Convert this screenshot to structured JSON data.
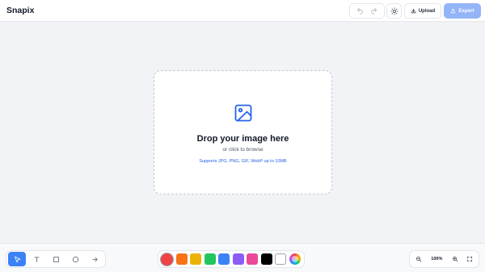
{
  "header": {
    "title": "Snapix",
    "undo_icon": "undo-icon",
    "redo_icon": "redo-icon",
    "theme_icon": "sun-icon",
    "upload_label": "Upload",
    "export_label": "Export"
  },
  "dropzone": {
    "icon": "image-icon",
    "title": "Drop your image here",
    "subtitle": "or click to browse",
    "formats": "Supports JPG, PNG, GIF, WebP up to 10MB"
  },
  "toolbar": {
    "tools": [
      {
        "name": "select",
        "icon": "cursor-icon",
        "active": true
      },
      {
        "name": "text",
        "icon": "text-icon",
        "active": false
      },
      {
        "name": "rectangle",
        "icon": "rectangle-icon",
        "active": false
      },
      {
        "name": "circle",
        "icon": "circle-icon",
        "active": false
      },
      {
        "name": "arrow",
        "icon": "arrow-icon",
        "active": false
      }
    ],
    "colors": [
      {
        "name": "red",
        "hex": "#ef4444",
        "selected": true
      },
      {
        "name": "orange",
        "hex": "#f97316"
      },
      {
        "name": "yellow",
        "hex": "#eab308"
      },
      {
        "name": "green",
        "hex": "#22c55e"
      },
      {
        "name": "blue",
        "hex": "#3b82f6"
      },
      {
        "name": "purple",
        "hex": "#8b5cf6"
      },
      {
        "name": "pink",
        "hex": "#ec4899"
      },
      {
        "name": "black",
        "hex": "#000000"
      },
      {
        "name": "white",
        "hex": "#ffffff"
      },
      {
        "name": "custom",
        "hex": "rainbow"
      }
    ],
    "zoom_level": "100%"
  },
  "colors": {
    "accent": "#3b82f6",
    "export_disabled": "#93b4f7",
    "link": "#2563eb"
  }
}
